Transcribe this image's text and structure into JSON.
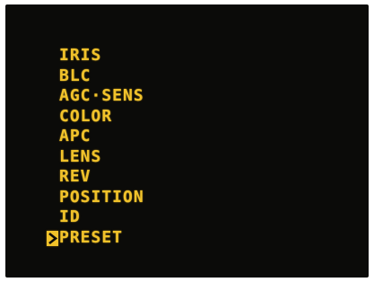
{
  "menu": {
    "items": [
      {
        "label": "IRIS"
      },
      {
        "label": "BLC"
      },
      {
        "label": "AGC·SENS"
      },
      {
        "label": "COLOR"
      },
      {
        "label": "APC"
      },
      {
        "label": "LENS"
      },
      {
        "label": "REV"
      },
      {
        "label": "POSITION"
      },
      {
        "label": "ID"
      },
      {
        "label": "PRESET",
        "selected": true
      }
    ],
    "cursor_icon": "arrow-right-icon",
    "text_color": "#f1c22a",
    "background_color": "#0b0b09"
  }
}
